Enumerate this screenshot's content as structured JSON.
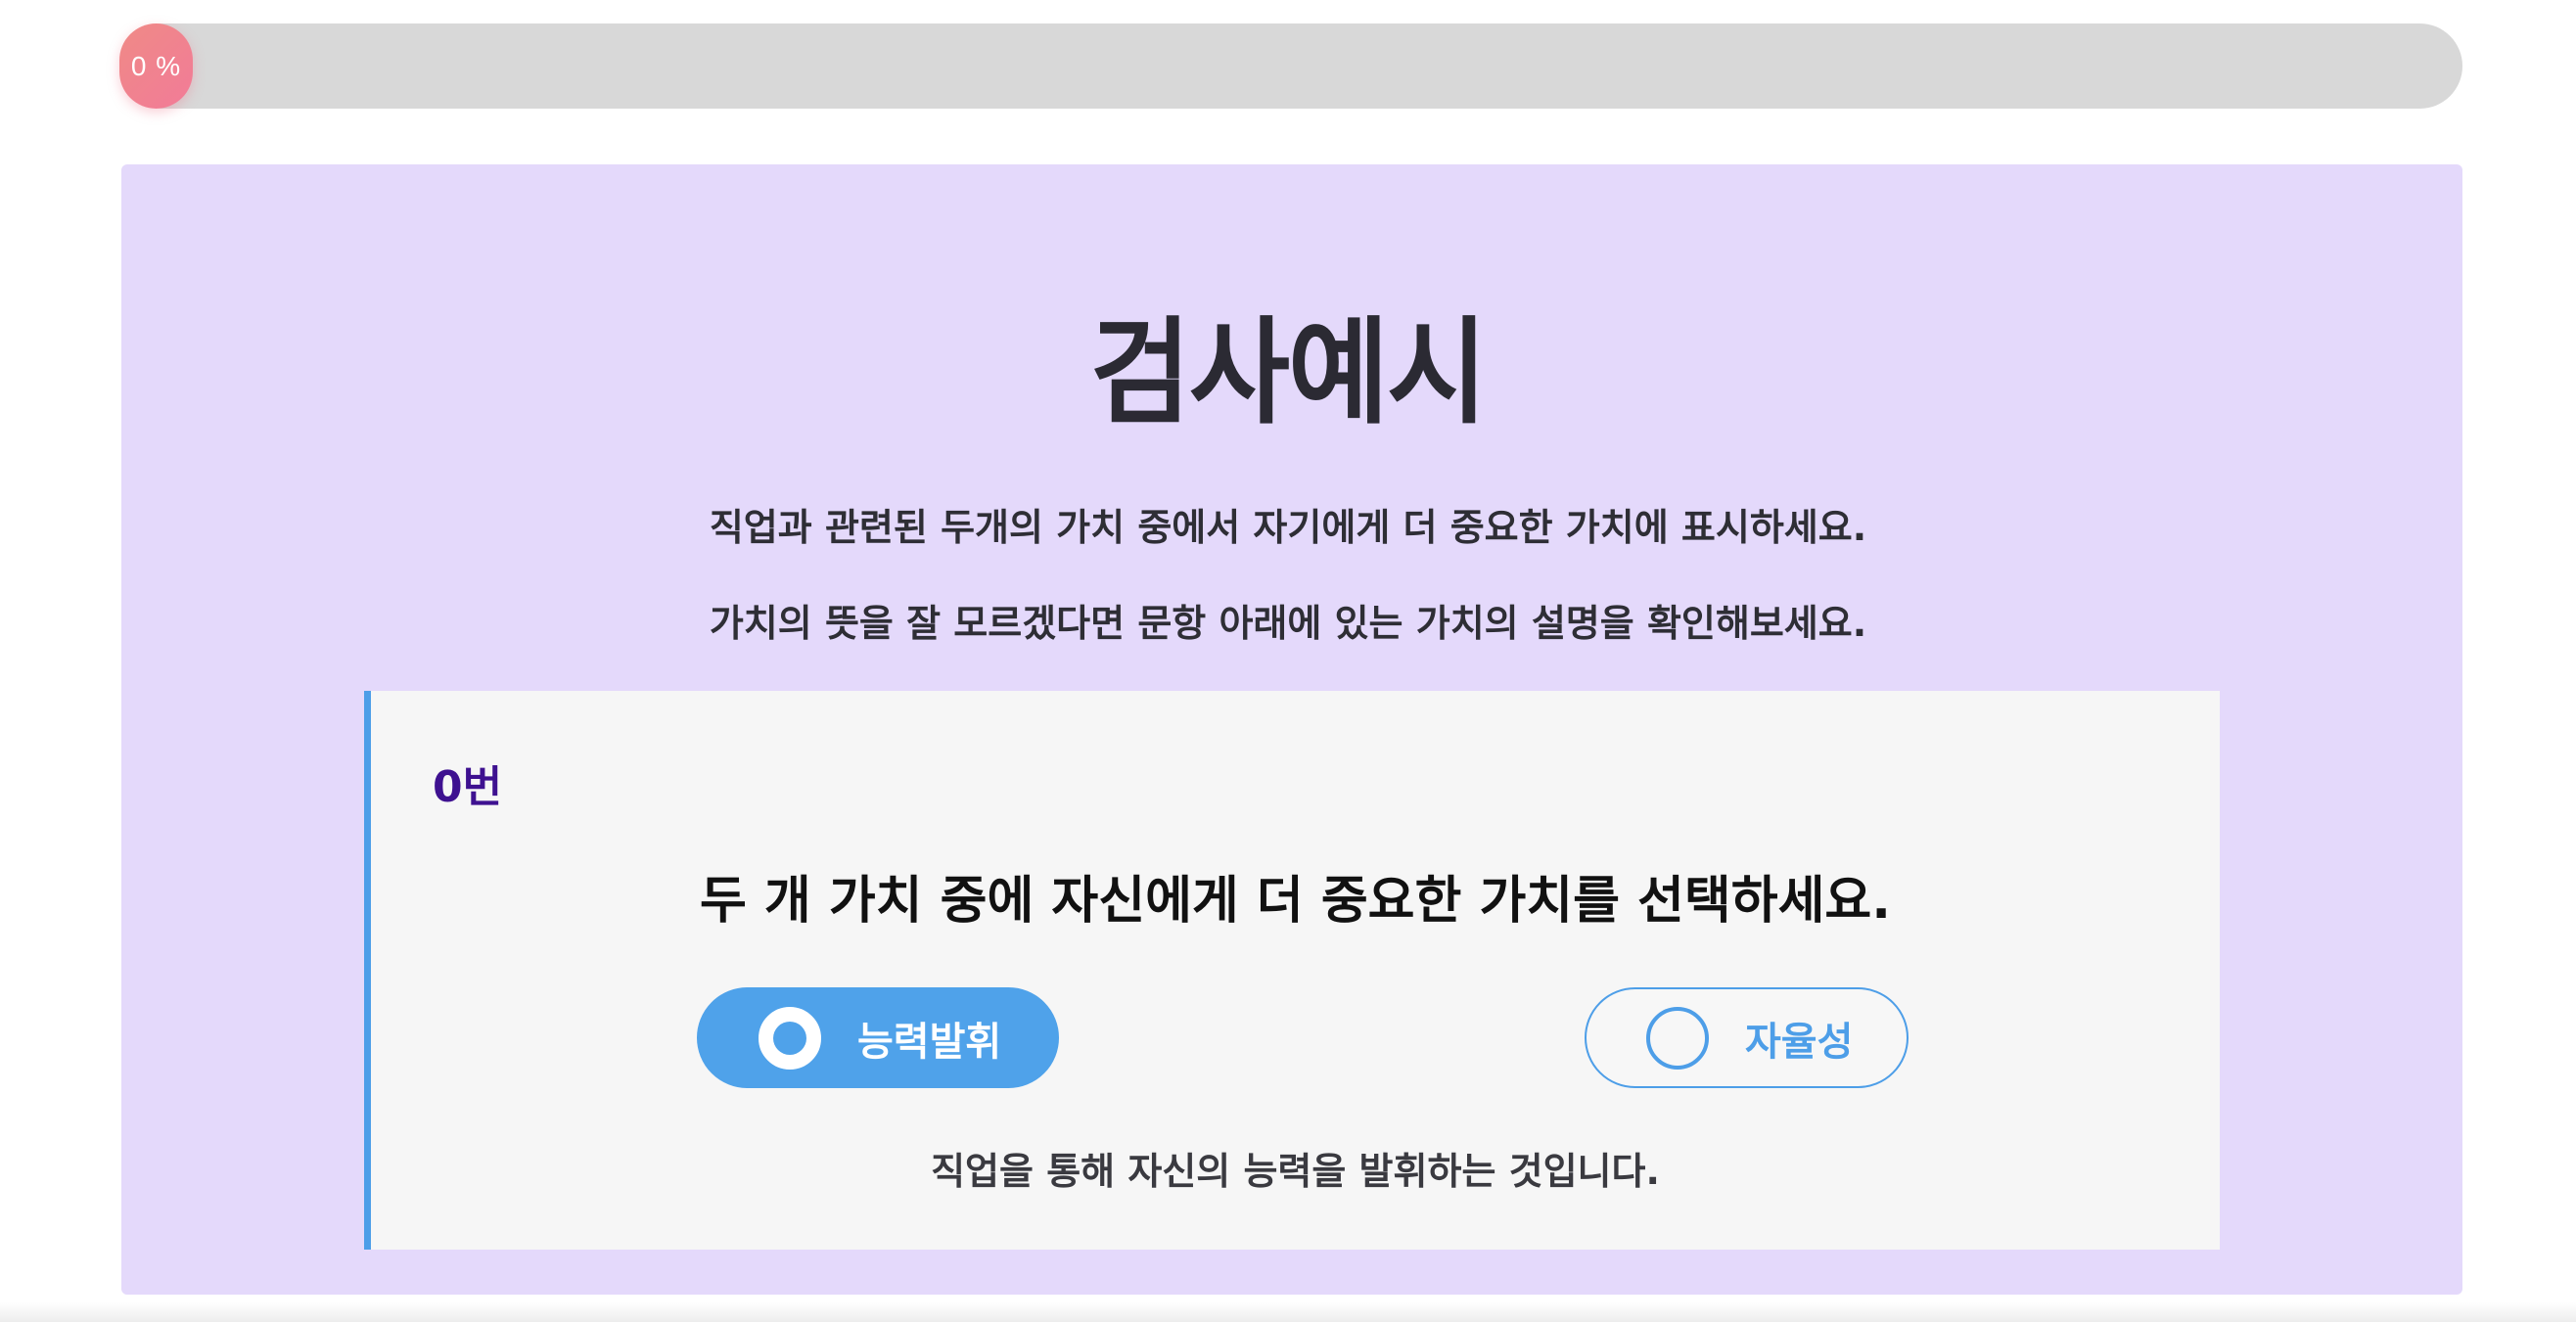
{
  "progress": {
    "value_percent": 0,
    "label": "0 %"
  },
  "intro": {
    "title": "검사예시",
    "instruction_1": "직업과 관련된 두개의 가치 중에서 자기에게 더 중요한 가치에 표시하세요.",
    "instruction_2": "가치의 뜻을 잘 모르겠다면 문항 아래에 있는 가치의 설명을 확인해보세요."
  },
  "question": {
    "number": "0번",
    "prompt": "두 개 가치 중에 자신에게 더 중요한 가치를 선택하세요.",
    "options": [
      {
        "label": "능력발휘",
        "selected": true
      },
      {
        "label": "자율성",
        "selected": false
      }
    ],
    "description": "직업을 통해 자신의 능력을 발휘하는 것입니다."
  },
  "colors": {
    "panel_bg": "#e4d9fb",
    "accent_blue": "#4fa2ea",
    "number_purple": "#3e1190",
    "progress_track": "#d8d8d8",
    "progress_knob": "#ef8a86"
  }
}
